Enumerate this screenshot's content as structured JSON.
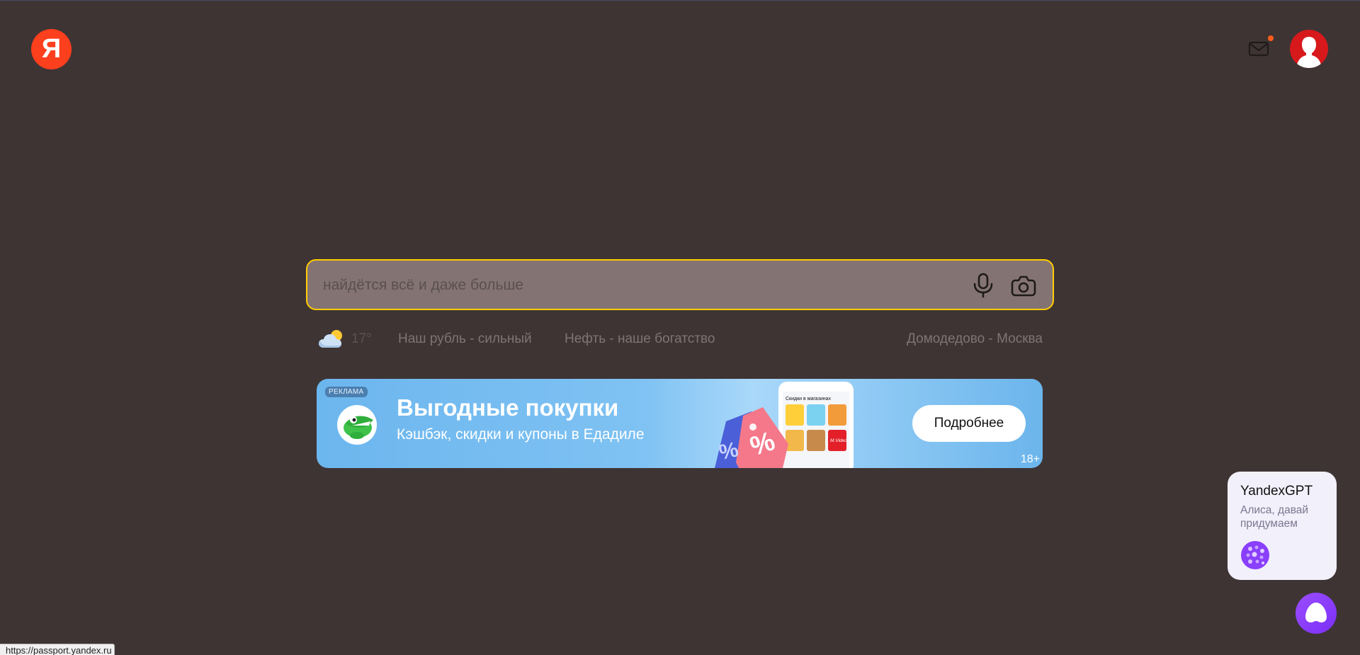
{
  "header": {
    "logo_text": "Я",
    "logo_color": "#fc3f1d",
    "mail_icon": "mail-icon",
    "notification_dot_color": "#ff5c1a",
    "avatar_color": "#d7191c"
  },
  "search": {
    "placeholder": "найдётся всё и даже больше",
    "value": "",
    "border_color": "#ffcc00",
    "mic_icon": "microphone-icon",
    "camera_icon": "camera-search-icon"
  },
  "informers": {
    "weather_icon": "cloud-sun-icon",
    "weather_temp": "17°",
    "news": [
      "Наш рубль - сильный",
      "Нефть - наше богатство"
    ],
    "traffic_route": "Домодедово - Москва"
  },
  "banner": {
    "ad_label": "РЕКЛАМА",
    "title": "Выгодные покупки",
    "subtitle": "Кэшбэк, скидки и купоны в Едадиле",
    "button_label": "Подробнее",
    "age_rating": "18+",
    "art_caption": "Скидки в магазинах",
    "art_brand": "M.Video",
    "background_color": "#6cb6ee"
  },
  "gpt_card": {
    "title": "YandexGPT",
    "text": "Алиса, давай придумаем",
    "accent_color": "#8a3ffc"
  },
  "alice": {
    "icon": "alice-icon",
    "color": "#8a3ffc"
  },
  "status_bar": {
    "url": "https://passport.yandex.ru"
  }
}
